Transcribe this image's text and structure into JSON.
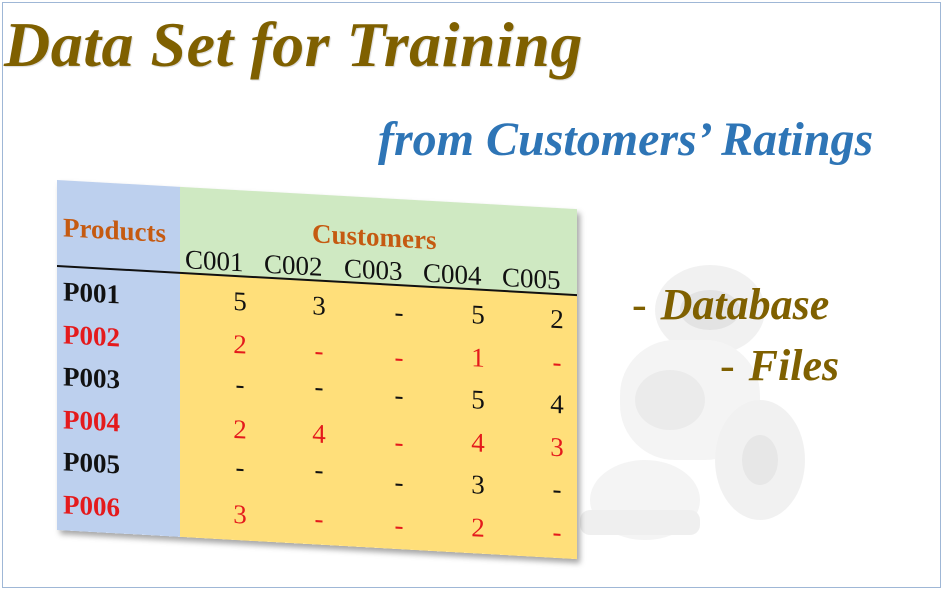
{
  "title": "Data Set for Training",
  "subtitle": "from Customers’ Ratings",
  "bullets": [
    {
      "dash": "-",
      "text": "Database"
    },
    {
      "dash": "-",
      "text": "Files"
    }
  ],
  "table": {
    "row_header_label": "Products",
    "column_group_label": "Customers",
    "customers": [
      "C001",
      "C002",
      "C003",
      "C004",
      "C005"
    ],
    "products": [
      "P001",
      "P002",
      "P003",
      "P004",
      "P005",
      "P006"
    ],
    "ratings": [
      [
        "5",
        "3",
        "-",
        "5",
        "2"
      ],
      [
        "2",
        "-",
        "-",
        "1",
        "-"
      ],
      [
        "-",
        "-",
        "-",
        "5",
        "4"
      ],
      [
        "2",
        "4",
        "-",
        "4",
        "3"
      ],
      [
        "-",
        "-",
        "-",
        "3",
        "-"
      ],
      [
        "3",
        "-",
        "-",
        "2",
        "-"
      ]
    ]
  },
  "colors": {
    "title": "#7f6000",
    "subtitle": "#2e75b6",
    "label_orange": "#c55a11",
    "red_row": "#e41a1c",
    "product_column_bg": "#bdd0ee",
    "customer_header_bg": "#cfe9c2",
    "ratings_bg": "#ffdf7a"
  },
  "decor": {
    "background_image": "robot-illustration"
  }
}
